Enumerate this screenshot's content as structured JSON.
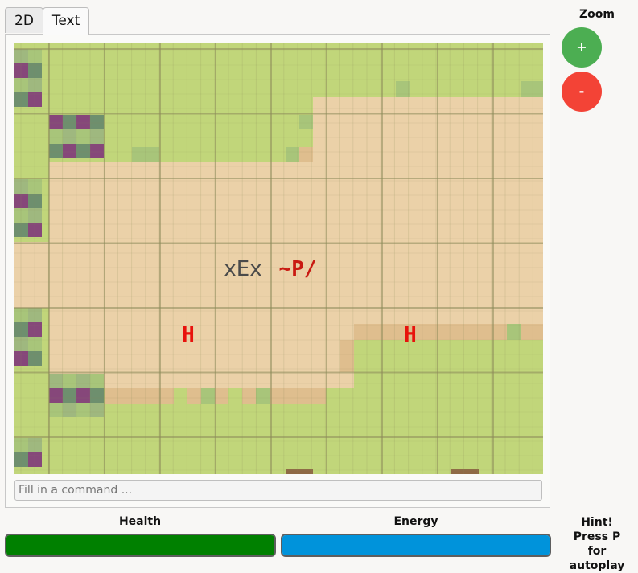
{
  "tabs": [
    {
      "label": "2D",
      "active": false
    },
    {
      "label": "Text",
      "active": true
    }
  ],
  "map": {
    "player_label": "xEx",
    "npc_label": "~P/",
    "hazard_label": "H",
    "colors": {
      "grass": "#c1d67a",
      "grass_light": "#c6d97f",
      "dirt": "#ebd1a8",
      "dirt_dark": "#dfbe8e",
      "grid": "#8c8b59",
      "rock": "#8f6a45",
      "bush_green": "#a8c57a",
      "bush_magenta": "#86477a",
      "player": "#4a4a4a",
      "npc": "#c91a12",
      "hazard": "#e8120c"
    }
  },
  "command": {
    "placeholder": "Fill in a command ..."
  },
  "zoom": {
    "title": "Zoom",
    "in_label": "+",
    "out_label": "-",
    "in_color": "#4cae52",
    "out_color": "#f34336"
  },
  "status": {
    "health_label": "Health",
    "energy_label": "Energy",
    "health_level": 1.0,
    "energy_level": 1.0,
    "health_color": "#008000",
    "energy_color": "#0093db"
  },
  "hint": {
    "line1": "Hint!",
    "line2": "Press P",
    "line3": "for autoplay"
  }
}
